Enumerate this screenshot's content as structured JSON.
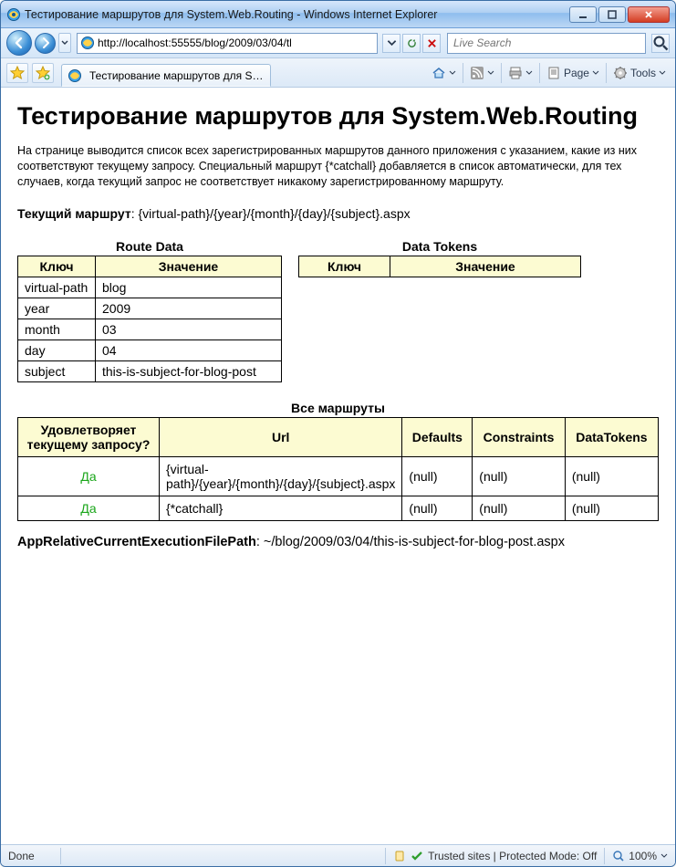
{
  "window": {
    "title": "Тестирование маршрутов для System.Web.Routing - Windows Internet Explorer"
  },
  "nav": {
    "url": "http://localhost:55555/blog/2009/03/04/tl",
    "search_placeholder": "Live Search"
  },
  "tab": {
    "label": "Тестирование маршрутов для Syste..."
  },
  "toolbar": {
    "page_label": "Page",
    "tools_label": "Tools"
  },
  "page": {
    "h1": "Тестирование маршрутов для System.Web.Routing",
    "intro": "На странице выводится список всех зарегистрированных маршрутов данного приложения с указанием, какие из них соответствуют текущему запросу. Специальный маршрут {*catchall} добавляется в список автоматически, для тех случаев, когда текущий запрос не соответствует никакому зарегистрированному маршруту.",
    "current_route_label": "Текущий маршрут",
    "current_route_value": "{virtual-path}/{year}/{month}/{day}/{subject}.aspx",
    "route_data_title": "Route Data",
    "data_tokens_title": "Data Tokens",
    "col_key": "Ключ",
    "col_value": "Значение",
    "route_data": [
      {
        "k": "virtual-path",
        "v": "blog"
      },
      {
        "k": "year",
        "v": "2009"
      },
      {
        "k": "month",
        "v": "03"
      },
      {
        "k": "day",
        "v": "04"
      },
      {
        "k": "subject",
        "v": "this-is-subject-for-blog-post"
      }
    ],
    "all_routes_title": "Все маршруты",
    "routes_cols": {
      "match": "Удовлетворяет текущему запросу?",
      "url": "Url",
      "defaults": "Defaults",
      "constraints": "Constraints",
      "datatokens": "DataTokens"
    },
    "routes": [
      {
        "match": "Да",
        "url": "{virtual-path}/{year}/{month}/{day}/{subject}.aspx",
        "defaults": "(null)",
        "constraints": "(null)",
        "datatokens": "(null)"
      },
      {
        "match": "Да",
        "url": "{*catchall}",
        "defaults": "(null)",
        "constraints": "(null)",
        "datatokens": "(null)"
      }
    ],
    "app_path_label": "AppRelativeCurrentExecutionFilePath",
    "app_path_value": "~/blog/2009/03/04/this-is-subject-for-blog-post.aspx"
  },
  "status": {
    "done": "Done",
    "trusted": "Trusted sites | Protected Mode: Off",
    "zoom": "100%"
  }
}
